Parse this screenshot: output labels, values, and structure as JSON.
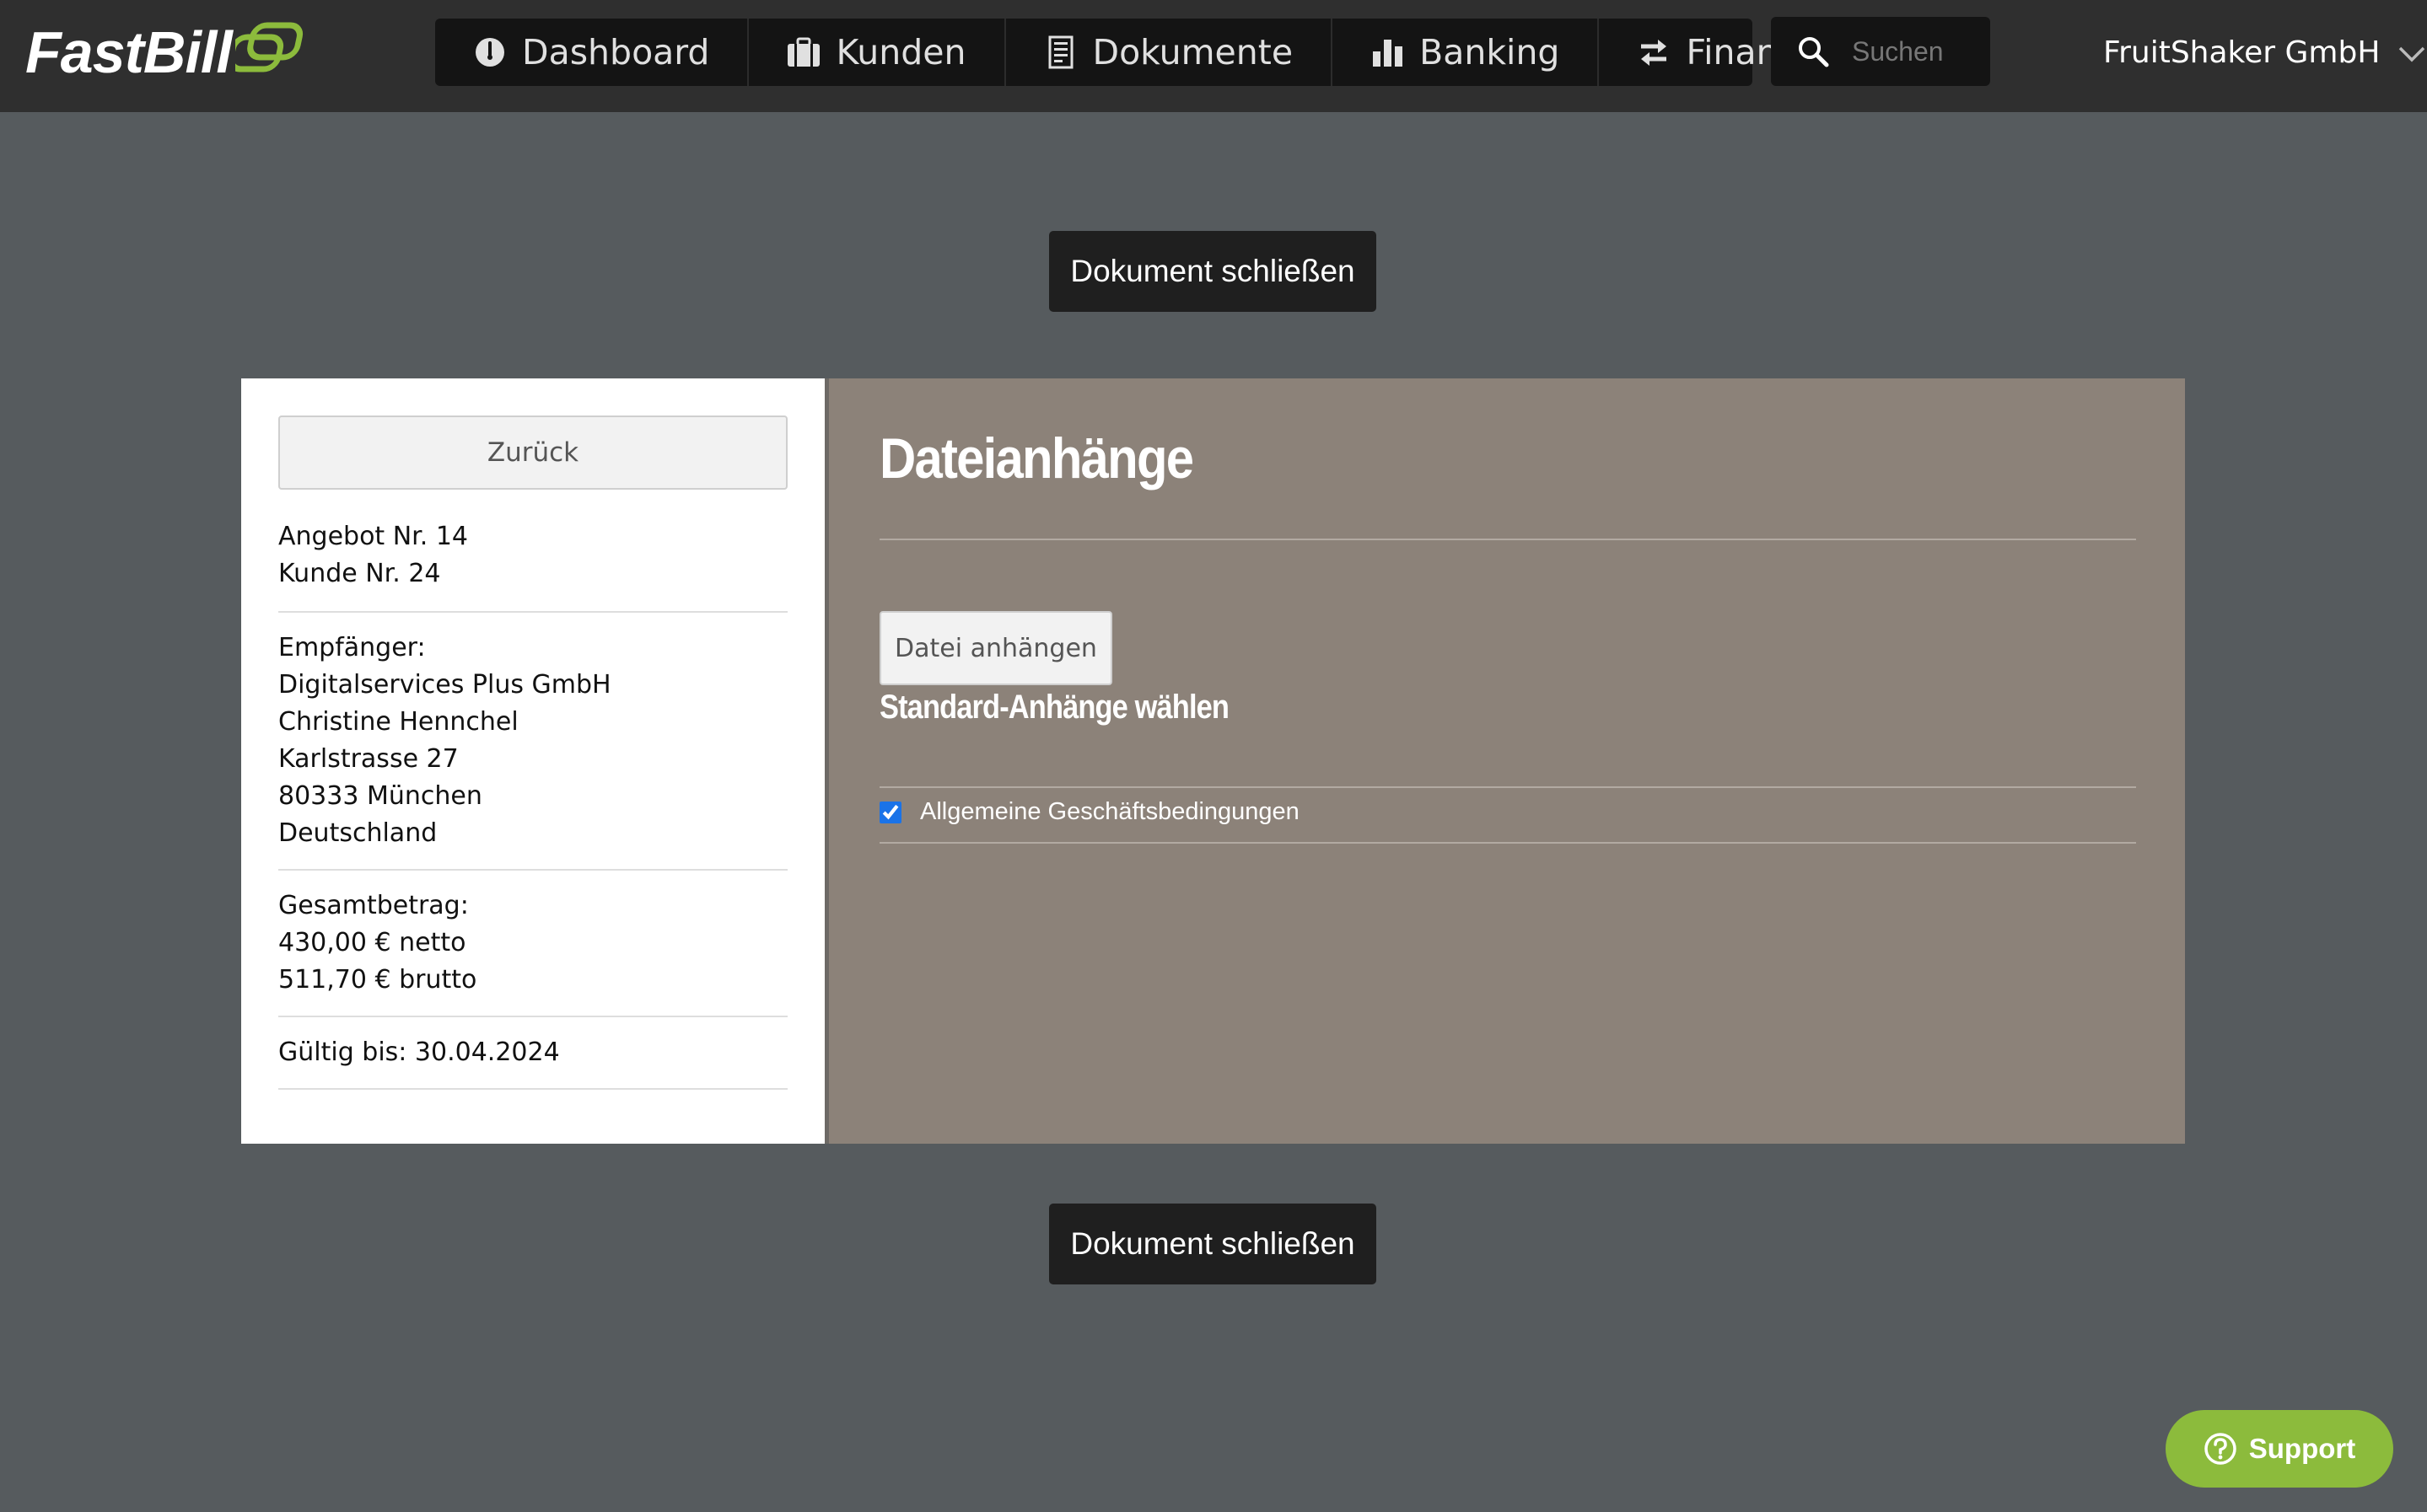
{
  "app": {
    "logo_text": "FastBill"
  },
  "nav": {
    "items": [
      {
        "label": "Dashboard",
        "icon": "dashboard-gauge-icon"
      },
      {
        "label": "Kunden",
        "icon": "briefcase-icon"
      },
      {
        "label": "Dokumente",
        "icon": "document-icon"
      },
      {
        "label": "Banking",
        "icon": "bar-chart-icon"
      },
      {
        "label": "Finanzen",
        "icon": "transfer-arrows-icon"
      }
    ]
  },
  "search": {
    "placeholder": "Suchen"
  },
  "account": {
    "company": "FruitShaker GmbH"
  },
  "actions": {
    "close_document_top": "Dokument schließen",
    "close_document_bottom": "Dokument schließen"
  },
  "sidebar": {
    "back_label": "Zurück",
    "offer_number": "Angebot Nr. 14",
    "customer_number": "Kunde Nr. 24",
    "recipient_label": "Empfänger:",
    "recipient_lines": [
      "Digitalservices Plus GmbH",
      "Christine Hennchel",
      "Karlstrasse 27",
      "80333 München",
      "Deutschland"
    ],
    "total_label": "Gesamtbetrag:",
    "net": "430,00 € netto",
    "gross": "511,70 € brutto",
    "valid_until": "Gültig bis: 30.04.2024"
  },
  "attachments": {
    "title": "Dateianhänge",
    "attach_button": "Datei anhängen",
    "standard_title": "Standard-Anhänge wählen",
    "standard_items": [
      {
        "label": "Allgemeine Geschäftsbedingungen",
        "checked": true
      }
    ]
  },
  "support": {
    "label": "Support"
  },
  "colors": {
    "background": "#565b5e",
    "topbar": "#2f2f2f",
    "nav": "#141414",
    "panel": "#8c8279",
    "brand_green": "#8cbb3c",
    "checkbox": "#1a73e8"
  }
}
